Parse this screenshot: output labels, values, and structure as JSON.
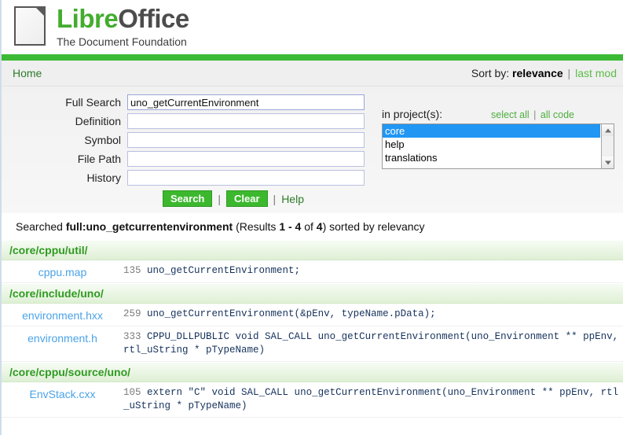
{
  "brand": {
    "name_part1": "Libre",
    "name_part2": "Office",
    "tagline": "The Document Foundation",
    "logo_icon": "document-icon",
    "green": "#3cba35",
    "link_blue": "#4aa3e8"
  },
  "navbar": {
    "home_label": "Home",
    "sort_prefix": "Sort by:",
    "sort_active": "relevance",
    "sort_separator": "|",
    "sort_other": "last mod"
  },
  "form": {
    "fields": [
      {
        "label": "Full Search",
        "value": "uno_getCurrentEnvironment",
        "placeholder": ""
      },
      {
        "label": "Definition",
        "value": "",
        "placeholder": ""
      },
      {
        "label": "Symbol",
        "value": "",
        "placeholder": ""
      },
      {
        "label": "File Path",
        "value": "",
        "placeholder": ""
      },
      {
        "label": "History",
        "value": "",
        "placeholder": ""
      }
    ],
    "projects": {
      "label": "in project(s):",
      "select_all": "select all",
      "separator": "|",
      "all_code": "all code",
      "options": [
        "core",
        "help",
        "translations"
      ],
      "selected": "core"
    },
    "buttons": {
      "search": "Search",
      "clear": "Clear",
      "separator1": "|",
      "separator2": "|",
      "help": "Help"
    }
  },
  "summary": {
    "prefix": "Searched ",
    "query": "full:uno_getcurrentenvironment",
    "results_open": " (Results ",
    "range": "1 - 4",
    "of": " of ",
    "total": "4",
    "suffix": ") sorted by relevancy"
  },
  "results": [
    {
      "directory": "/core/cppu/util/",
      "hits": [
        {
          "file": "cppu.map",
          "line": "135",
          "code": "uno_getCurrentEnvironment;"
        }
      ]
    },
    {
      "directory": "/core/include/uno/",
      "hits": [
        {
          "file": "environment.hxx",
          "line": "259",
          "code": "uno_getCurrentEnvironment(&pEnv, typeName.pData);"
        },
        {
          "file": "environment.h",
          "line": "333",
          "code": "CPPU_DLLPUBLIC void SAL_CALL uno_getCurrentEnvironment(uno_Environment ** ppEnv, rtl_uString * pTypeName)"
        }
      ]
    },
    {
      "directory": "/core/cppu/source/uno/",
      "hits": [
        {
          "file": "EnvStack.cxx",
          "line": "105",
          "code": "extern \"C\" void SAL_CALL uno_getCurrentEnvironment(uno_Environment ** ppEnv, rtl_uString * pTypeName)"
        }
      ]
    }
  ]
}
